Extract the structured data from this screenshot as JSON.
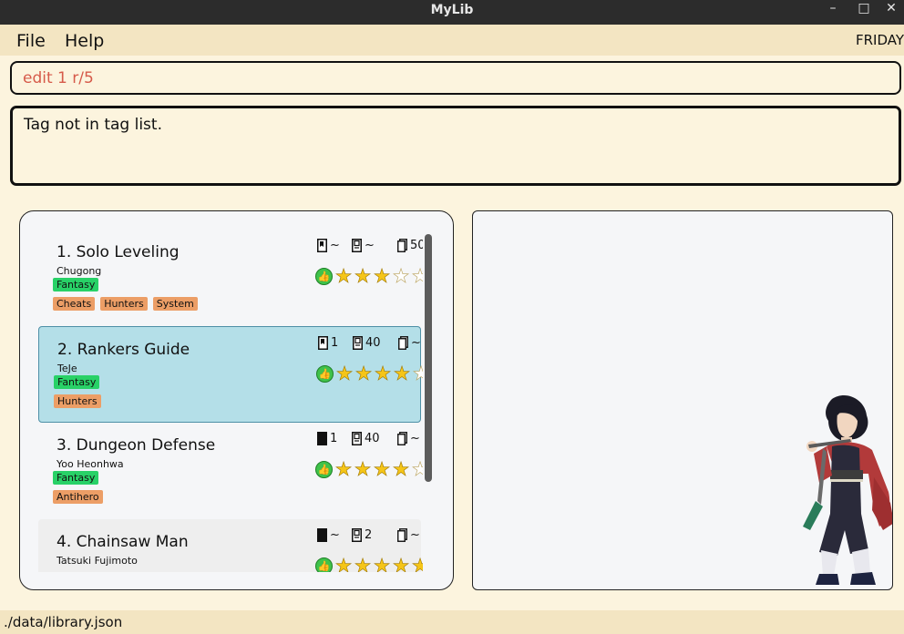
{
  "window": {
    "title": "MyLib",
    "minimize": "–",
    "maximize": "□",
    "close": "✕"
  },
  "menubar": {
    "file": "File",
    "help": "Help",
    "day": "FRIDAY"
  },
  "command": {
    "value": "edit 1 r/5"
  },
  "result": {
    "text": "Tag not in tag list."
  },
  "books": [
    {
      "name": "1. Solo Leveling",
      "author": "Chugong",
      "genre": "Fantasy",
      "tags": [
        "Cheats",
        "Hunters",
        "System"
      ],
      "read": "~",
      "total": "~",
      "pages": "50",
      "rating": 3,
      "selected": false
    },
    {
      "name": "2. Rankers Guide",
      "author": "TeJe",
      "genre": "Fantasy",
      "tags": [
        "Hunters"
      ],
      "read": "1",
      "total": "40",
      "pages": "~",
      "rating": 4,
      "selected": true
    },
    {
      "name": "3. Dungeon Defense",
      "author": "Yoo Heonhwa",
      "genre": "Fantasy",
      "tags": [
        "Antihero"
      ],
      "read": "1",
      "total": "40",
      "pages": "~",
      "rating": 4,
      "selected": false
    },
    {
      "name": "4. Chainsaw Man",
      "author": "Tatsuki Fujimoto",
      "genre": "",
      "tags": [],
      "read": "~",
      "total": "2",
      "pages": "~",
      "rating": 5,
      "selected": false
    }
  ],
  "status": {
    "path": "./data/library.json"
  },
  "colors": {
    "background": "#fcf4de",
    "genreTag": "#28d167",
    "tag": "#ec9e66",
    "selected": "#b4dfe8",
    "commandText": "#d65a4a"
  }
}
